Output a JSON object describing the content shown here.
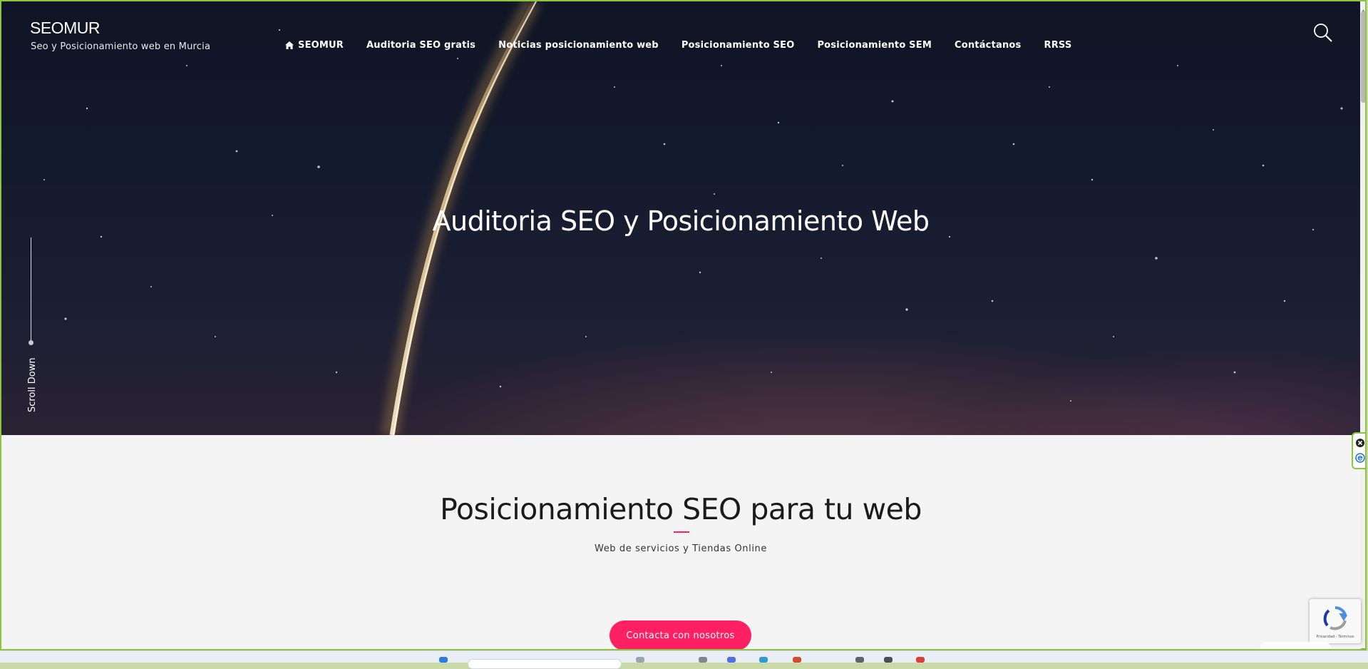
{
  "header": {
    "brand_title": "SEOMUR",
    "brand_subtitle": "Seo y Posicionamiento web en Murcia",
    "nav": [
      {
        "label": "SEOMUR",
        "icon": "home-icon"
      },
      {
        "label": "Auditoria SEO gratis"
      },
      {
        "label": "Noticias posicionamiento web"
      },
      {
        "label": "Posicionamiento SEO"
      },
      {
        "label": "Posicionamiento SEM"
      },
      {
        "label": "Contáctanos"
      },
      {
        "label": "RRSS"
      }
    ],
    "search_icon": "search-icon"
  },
  "hero": {
    "title": "Auditoria SEO y Posicionamiento Web",
    "scroll_label": "Scroll Down"
  },
  "section": {
    "title": "Posicionamiento SEO para tu web",
    "subtitle": "Web de servicios y Tiendas Online",
    "cta_label": "Contacta con nosotros"
  },
  "recaptcha": {
    "text": "Privacidad - Términos"
  },
  "colors": {
    "accent": "#ff1f63",
    "hero_bg": "#141a2e",
    "frame": "#8cc63f",
    "content_bg": "#f4f4f4"
  }
}
